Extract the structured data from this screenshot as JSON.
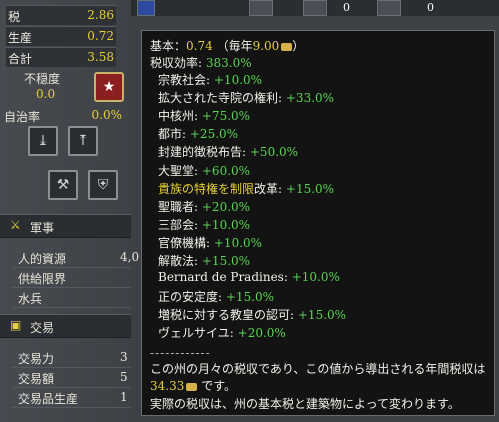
{
  "left": {
    "stats": [
      {
        "label": "税",
        "value": "2.86"
      },
      {
        "label": "生産",
        "value": "0.72"
      },
      {
        "label": "合計",
        "value": "3.58"
      }
    ],
    "unrest_label": "不穏度",
    "unrest_value": "0.0",
    "autonomy_label": "自治率",
    "autonomy_value": "0.0%",
    "military": {
      "title": "軍事",
      "rows": [
        {
          "label": "人的資源",
          "value": "4,0"
        },
        {
          "label": "供給限界",
          "value": ""
        },
        {
          "label": "水兵",
          "value": ""
        }
      ]
    },
    "trade": {
      "title": "交易",
      "rows": [
        {
          "label": "交易力",
          "value": "3"
        },
        {
          "label": "交易額",
          "value": "5"
        },
        {
          "label": "交易品生産",
          "value": "1"
        }
      ]
    }
  },
  "topbar": {
    "counts": [
      "0",
      "0"
    ]
  },
  "tooltip": {
    "base_label": "基本：",
    "base_value": "0.74",
    "yearly_open": "（毎年",
    "yearly_value": "9.00",
    "yearly_close": "）",
    "efficiency_label": "税収効率:",
    "efficiency_value": "383.0%",
    "modifiers": [
      {
        "label": "宗教社会:",
        "value": "+10.0%"
      },
      {
        "label": "拡大された寺院の権利:",
        "value": "+33.0%"
      },
      {
        "label": "中核州:",
        "value": "+75.0%"
      },
      {
        "label": "都市:",
        "value": "+25.0%"
      },
      {
        "label": "封建的徴税布告:",
        "value": "+50.0%"
      },
      {
        "label": "大聖堂:",
        "value": "+60.0%"
      },
      {
        "label": "改革:",
        "value": "+15.0%",
        "prefix": "貴族の特権を制限"
      },
      {
        "label": "聖職者:",
        "value": "+20.0%"
      },
      {
        "label": "三部会:",
        "value": "+10.0%"
      },
      {
        "label": "官僚機構:",
        "value": "+10.0%"
      },
      {
        "label": "解散法:",
        "value": "+15.0%"
      },
      {
        "label": "Bernard de Pradines:",
        "value": "+10.0%"
      },
      {
        "label": "正の安定度:",
        "value": "+15.0%"
      },
      {
        "label": "増税に対する教皇の認可:",
        "value": "+15.0%"
      },
      {
        "label": "ヴェルサイユ:",
        "value": "+20.0%"
      }
    ],
    "separator": "------------",
    "desc1": "この州の月々の税収であり、この値から導出される年間税収は",
    "desc2_value": "34.33",
    "desc2_suffix": "です。",
    "desc3": "実際の税収は、州の基本税と建築物によって変わります。"
  },
  "colors": {
    "positive": "#5ad253",
    "highlight": "#e6cf3a",
    "tooltip_bg": "#131313"
  }
}
